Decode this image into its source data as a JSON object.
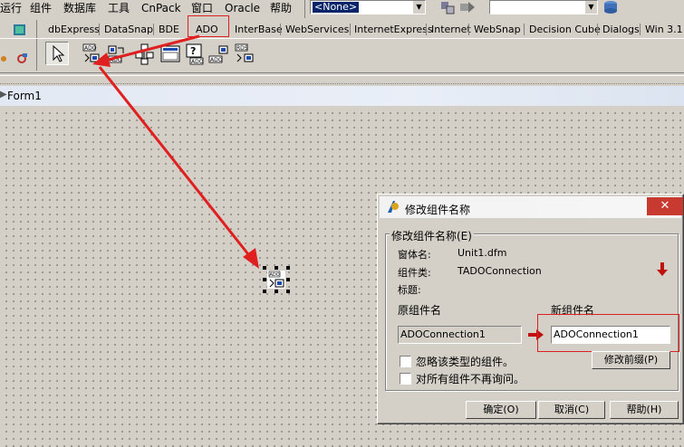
{
  "menu": [
    "运行",
    "组件",
    "数据库",
    "工具",
    "CnPack",
    "窗口",
    "Oracle",
    "帮助"
  ],
  "toolbar": {
    "combo_value": "<None>"
  },
  "palette_tabs": [
    "dbExpress",
    "DataSnap",
    "BDE",
    "ADO",
    "InterBase",
    "WebServices",
    "InternetExpress",
    "Internet",
    "WebSnap",
    "Decision Cube",
    "Dialogs",
    "Win 3.1"
  ],
  "palette_icons": [
    "pointer-icon",
    "ado-connection-icon",
    "ado-command-icon",
    "ado-dataset-icon",
    "ado-table-icon",
    "ado-query-icon",
    "ado-storedproc-icon",
    "rds-connection-icon"
  ],
  "form": {
    "title": "Form1",
    "component_label": "ADO"
  },
  "dialog": {
    "title": "修改组件名称",
    "group_title": "修改组件名称(E)",
    "form_name_label": "窗体名:",
    "form_name_value": "Unit1.dfm",
    "class_label": "组件类:",
    "class_value": "TADOConnection",
    "caption_label": "标题:",
    "old_name_label": "原组件名",
    "old_name_value": "ADOConnection1",
    "new_name_label": "新组件名",
    "new_name_value": "ADOConnection1",
    "ignore_type_label": "忽略该类型的组件。",
    "dont_ask_label": "对所有组件不再询问。",
    "modify_prefix_button": "修改前缀(P)",
    "ok_button": "确定(O)",
    "cancel_button": "取消(C)",
    "help_button": "帮助(H)"
  },
  "colors": {
    "annotation_red": "#e02020",
    "selection_blue": "#0a246a"
  }
}
